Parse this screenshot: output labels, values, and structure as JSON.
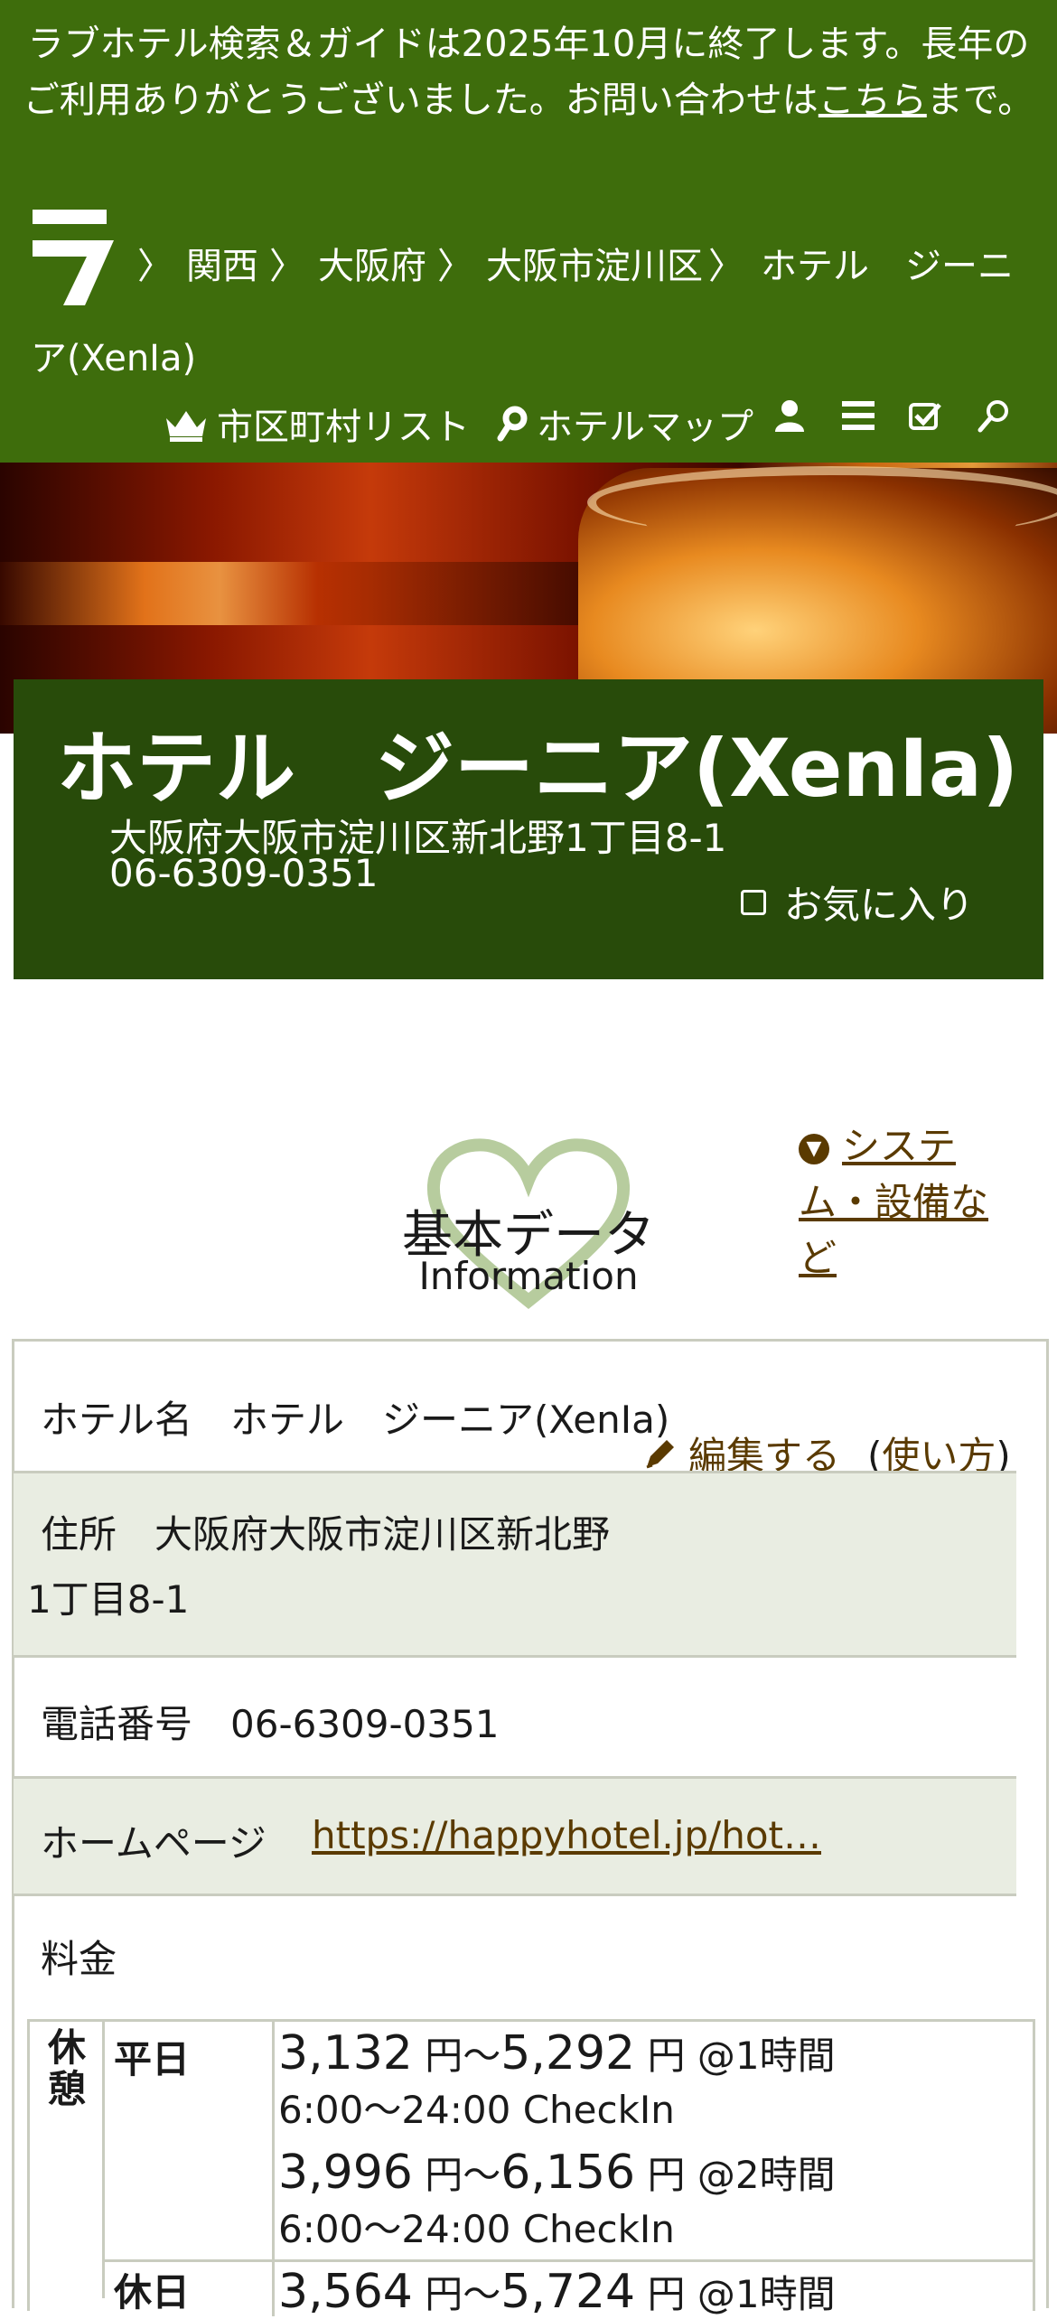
{
  "notice": {
    "text_before": "ラブホテル検索＆ガイドは2025年10月に終了します。長年のご利用ありがとうございました。お問い合わせは",
    "link": "こちら",
    "text_after": "まで。"
  },
  "breadcrumb": {
    "logo_char": "ラ",
    "separator": "〉",
    "items": [
      "関西",
      "大阪府",
      "大阪市淀川区",
      "ホテル　ジーニ",
      "ア(XenIa)"
    ]
  },
  "toolbar": {
    "city_list": "市区町村リスト",
    "hotel_map": "ホテルマップ"
  },
  "hotel": {
    "title": "ホテル　ジーニア(XenIa)",
    "address": "大阪府大阪市淀川区新北野1丁目8-1",
    "tel": "06-6309-0351",
    "favorite": "お気に入り"
  },
  "section": {
    "title_jp": "基本データ",
    "title_en": "Information",
    "system_link": "システム・設備など"
  },
  "edit": {
    "label": "編集する",
    "open": "(",
    "howto": "使い方",
    "close": ")"
  },
  "info": {
    "name_row": "ホテル名　ホテル　ジーニア(XenIa)",
    "address_row_1": "住所　大阪府大阪市淀川区新北野",
    "address_row_2": "1丁目8-1",
    "phone_row": "電話番号　06-6309-0351",
    "homepage_label": "ホームページ",
    "homepage_url": "https://happyhotel.jp/hot…",
    "price_label": "料金"
  },
  "prices": {
    "rest_label": "休憩",
    "weekday_label": "平日",
    "holiday_label": "休日",
    "weekday": [
      {
        "min": "3,132",
        "max": "5,292",
        "unit": "円",
        "range_sep": "〜",
        "duration": "@1時間",
        "time": "6:00〜24:00 CheckIn"
      },
      {
        "min": "3,996",
        "max": "6,156",
        "unit": "円",
        "range_sep": "〜",
        "duration": "@2時間",
        "time": "6:00〜24:00 CheckIn"
      }
    ],
    "holiday_first": {
      "min": "3,564",
      "max": "5,724",
      "unit": "円",
      "range_sep": "〜",
      "duration": "@1時間"
    }
  }
}
